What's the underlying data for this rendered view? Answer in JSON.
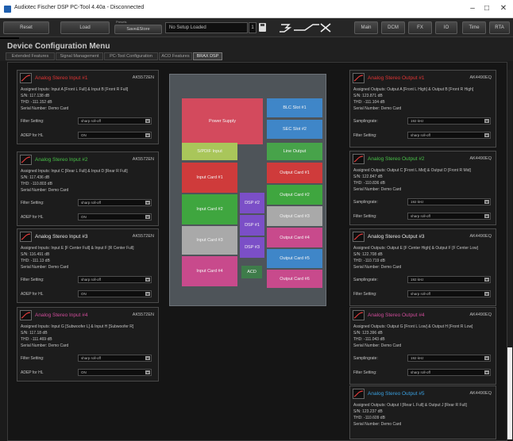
{
  "window": {
    "title": "Audiotec Fischer DSP PC-Tool 4.40a - Disconnected",
    "minimize": "–",
    "maximize": "□",
    "close": "✕"
  },
  "toolbar": {
    "reset_label": "Reset",
    "load_label": "Load",
    "presets_label": "Presets",
    "save_store_label": "Save&Store",
    "setup_value": "No Setup Loaded",
    "setup_number": "1",
    "logo_text": "3RAX",
    "main_label": "Main",
    "dcm_label": "DCM",
    "fx_label": "FX",
    "io_label": "IO",
    "time_label": "Time",
    "rta_label": "RTA"
  },
  "page": {
    "title": "Device Configuration Menu",
    "tabs": [
      "Extended Features",
      "Signal Management",
      "PC-Tool Configuration",
      "ACO Features",
      "BRAX DSP"
    ],
    "active_tab": 4
  },
  "inputs": [
    {
      "name": "Analog Stereo Input #1",
      "name_color": "#e03434",
      "chip": "AK5572EN",
      "assigned": "Assigned Inputs: Input A [Front L Full] & Input B [Front R Full]",
      "sn": "S/N: 117.138 dB",
      "thd": "THD: -111.152 dB",
      "serial": "Serial Number: Demo Card",
      "filter_label": "Filter Setting:",
      "filter_value": "sharp roll-off",
      "adep_label": "ADEP for HL",
      "adep_value": "ON"
    },
    {
      "name": "Analog Stereo Input #2",
      "name_color": "#48c048",
      "chip": "AK5572EN",
      "assigned": "Assigned Inputs: Input C [Rear L Full] & Input D [Rear R Full]",
      "sn": "S/N: 117.436 dB",
      "thd": "THD: -110.803 dB",
      "serial": "Serial Number: Demo Card",
      "filter_label": "Filter Setting:",
      "filter_value": "sharp roll-off",
      "adep_label": "ADEP for HL",
      "adep_value": "ON"
    },
    {
      "name": "Analog Stereo Input #3",
      "name_color": "#e6e6e6",
      "chip": "AK5572EN",
      "assigned": "Assigned Inputs: Input E [F Center Full] & Input F [R Center Full]",
      "sn": "S/N: 116.491 dB",
      "thd": "THD: -111.13 dB",
      "serial": "Serial Number: Demo Card",
      "filter_label": "Filter Setting:",
      "filter_value": "sharp roll-off",
      "adep_label": "ADEP for HL",
      "adep_value": "ON"
    },
    {
      "name": "Analog Stereo Input #4",
      "name_color": "#cf4c9a",
      "chip": "AK5572EN",
      "assigned": "Assigned Inputs: Input G [Subwoofer L] & Input H [Subwoofer R]",
      "sn": "S/N: 117.18 dB",
      "thd": "THD: -111.469 dB",
      "serial": "Serial Number: Demo Card",
      "filter_label": "Filter Setting:",
      "filter_value": "sharp roll-off",
      "adep_label": "ADEP for HL",
      "adep_value": "ON"
    }
  ],
  "outputs": [
    {
      "name": "Analog Stereo Output #1",
      "name_color": "#e03434",
      "chip": "AK4490EQ",
      "assigned": "Assigned Outputs: Output A [Front L High] & Output B [Front R High]",
      "sn": "S/N: 123.871 dB",
      "thd": "THD: -111.104 dB",
      "serial": "Serial Number: Demo Card",
      "sr_label": "Samplingrate:",
      "sr_value": "192 kHz",
      "filter_label": "Filter Setting:",
      "filter_value": "sharp roll-off"
    },
    {
      "name": "Analog Stereo Output #2",
      "name_color": "#48c048",
      "chip": "AK4490EQ",
      "assigned": "Assigned Outputs: Output C [Front L Mid] & Output D [Front R Mid]",
      "sn": "S/N: 122.847 dB",
      "thd": "THD: -110.836 dB",
      "serial": "Serial Number: Demo Card",
      "sr_label": "Samplingrate:",
      "sr_value": "192 kHz",
      "filter_label": "Filter Setting:",
      "filter_value": "sharp roll-off"
    },
    {
      "name": "Analog Stereo Output #3",
      "name_color": "#e6e6e6",
      "chip": "AK4490EQ",
      "assigned": "Assigned Outputs: Output E [F Center High] & Output F [F Center Low]",
      "sn": "S/N: 122.708 dB",
      "thd": "THD: -110.719 dB",
      "serial": "Serial Number: Demo Card",
      "sr_label": "Samplingrate:",
      "sr_value": "192 kHz",
      "filter_label": "Filter Setting:",
      "filter_value": "sharp roll-off"
    },
    {
      "name": "Analog Stereo Output #4",
      "name_color": "#cf4c9a",
      "chip": "AK4490EQ",
      "assigned": "Assigned Outputs: Output G [Front L Low] & Output H [Front R Low]",
      "sn": "S/N: 123.396 dB",
      "thd": "THD: -111.043 dB",
      "serial": "Serial Number: Demo Card",
      "sr_label": "Samplingrate:",
      "sr_value": "192 kHz",
      "filter_label": "Filter Setting:",
      "filter_value": "sharp roll-off"
    },
    {
      "name": "Analog Stereo Output #5",
      "name_color": "#3aa0e0",
      "chip": "AK4490EQ",
      "assigned": "Assigned Outputs: Output I [Rear L Full] & Output J [Rear R Full]",
      "sn": "S/N: 123.237 dB",
      "thd": "THD: -110.609 dB",
      "serial": "Serial Number: Demo Card",
      "sr_label": "Samplingrate:",
      "sr_value": "192 kHz",
      "filter_label": "Filter Setting:",
      "filter_value": "sharp roll-off"
    }
  ],
  "device": {
    "power_supply": "Power Supply",
    "blc_slot_1": "BLC Slot #1",
    "sec_slot_2": "SEC Slot #2",
    "spdif_input": "S/PDIF Input",
    "line_output": "Line Output",
    "input_card_1": "Input Card #1",
    "input_card_2": "Input Card #2",
    "input_card_3": "Input Card #3",
    "input_card_4": "Input Card #4",
    "output_card_1": "Output Card #1",
    "output_card_2": "Output Card #2",
    "output_card_3": "Output Card #3",
    "output_card_4": "Output Card #4",
    "output_card_5": "Output Card #5",
    "output_card_6": "Output Card #6",
    "dsp_1": "DSP #1",
    "dsp_2": "DSP #2",
    "dsp_3": "DSP #3",
    "acd": "ACD"
  },
  "colors": {
    "red_zone": "#d13b3b",
    "green_zone": "#3fa63f",
    "grey_zone": "#a9a9a9",
    "pink_zone": "#c84a8c",
    "blue_zone": "#3f86c8",
    "yellowgreen_zone": "#9bbf3f",
    "violet_zone": "#7b4fc7"
  }
}
